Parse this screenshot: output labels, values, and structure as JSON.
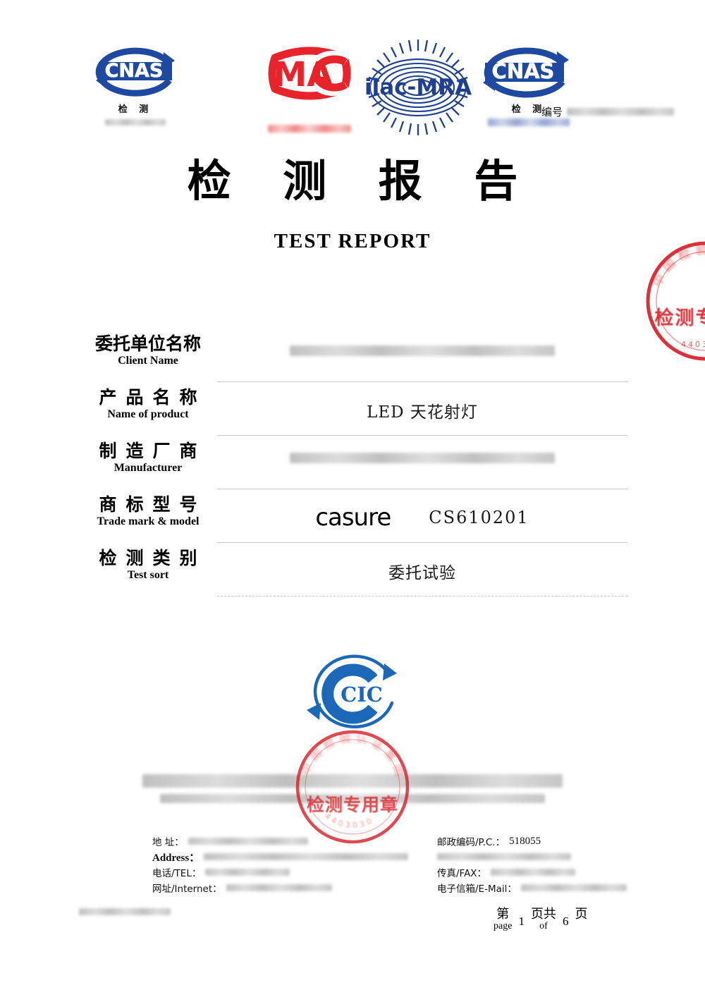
{
  "document": {
    "title_cn": "检 测 报 告",
    "title_en": "TEST    REPORT"
  },
  "accreditation": {
    "cnas_left": {
      "mark_text": "CNAS",
      "sub_label": "检 测",
      "code_redacted": true
    },
    "cma": {
      "mark_text": "MA",
      "code_redacted": true
    },
    "ilac": {
      "mark_text": "ilac-MRA"
    },
    "cnas_right": {
      "mark_text": "CNAS",
      "sub_label": "检 测",
      "code_redacted": true
    },
    "registration": {
      "label": "编号",
      "value_redacted": true
    }
  },
  "fields": [
    {
      "label_cn": "委托单位名称",
      "label_en": "Client Name",
      "value": "",
      "redacted": true,
      "spacing": "tight"
    },
    {
      "label_cn": "产品名称",
      "label_en": "Name of product",
      "value": "LED 天花射灯",
      "redacted": false,
      "spacing": "wide"
    },
    {
      "label_cn": "制造厂商",
      "label_en": "Manufacturer",
      "value": "",
      "redacted": true,
      "spacing": "wide"
    },
    {
      "label_cn": "商标型号",
      "label_en": "Trade mark & model",
      "value": "",
      "brand": "casure",
      "model": "CS610201",
      "redacted": false,
      "spacing": "wide"
    },
    {
      "label_cn": "检测类别",
      "label_en": "Test sort",
      "value": "委托试验",
      "redacted": false,
      "spacing": "wide"
    }
  ],
  "institute": {
    "logo_text": "CIC",
    "name_cn_redacted": true,
    "name_en_redacted": true
  },
  "contact": {
    "left": [
      {
        "label": "地  址：",
        "redacted": true,
        "blur_width": 170
      },
      {
        "label": "Address：",
        "serif": true,
        "redacted": true,
        "blur_width": 290
      },
      {
        "label": "电话/TEL：",
        "redacted": true,
        "blur_width": 120
      },
      {
        "label": "网址/Internet：",
        "redacted": true,
        "blur_width": 150
      }
    ],
    "right": [
      {
        "label": "邮政编码/P.C.：",
        "value": "518055",
        "redacted": false
      },
      {
        "label": "",
        "redacted": true,
        "blur_width": 190
      },
      {
        "label": "传真/FAX：",
        "redacted": true,
        "blur_width": 120
      },
      {
        "label": "电子信箱/E-Mail：",
        "redacted": true,
        "blur_width": 150
      }
    ]
  },
  "pagination": {
    "prefix_cn": "第",
    "prefix_en": "page",
    "current": "1",
    "middle_cn": "页共",
    "middle_en": "of",
    "total": "6",
    "suffix_cn": "页"
  },
  "doc_code": {
    "redacted": true
  },
  "stamps": {
    "right_seal_text": "检测专用章",
    "center_seal_text": "检测专用章"
  },
  "colors": {
    "cnas_blue": "#1d4aa0",
    "cma_red": "#e8232a",
    "ilac_blue": "#1f3f8f",
    "cic_blue": "#1c68b8",
    "seal_red": "#d8232a",
    "rule_grey": "#c9c9c9"
  }
}
